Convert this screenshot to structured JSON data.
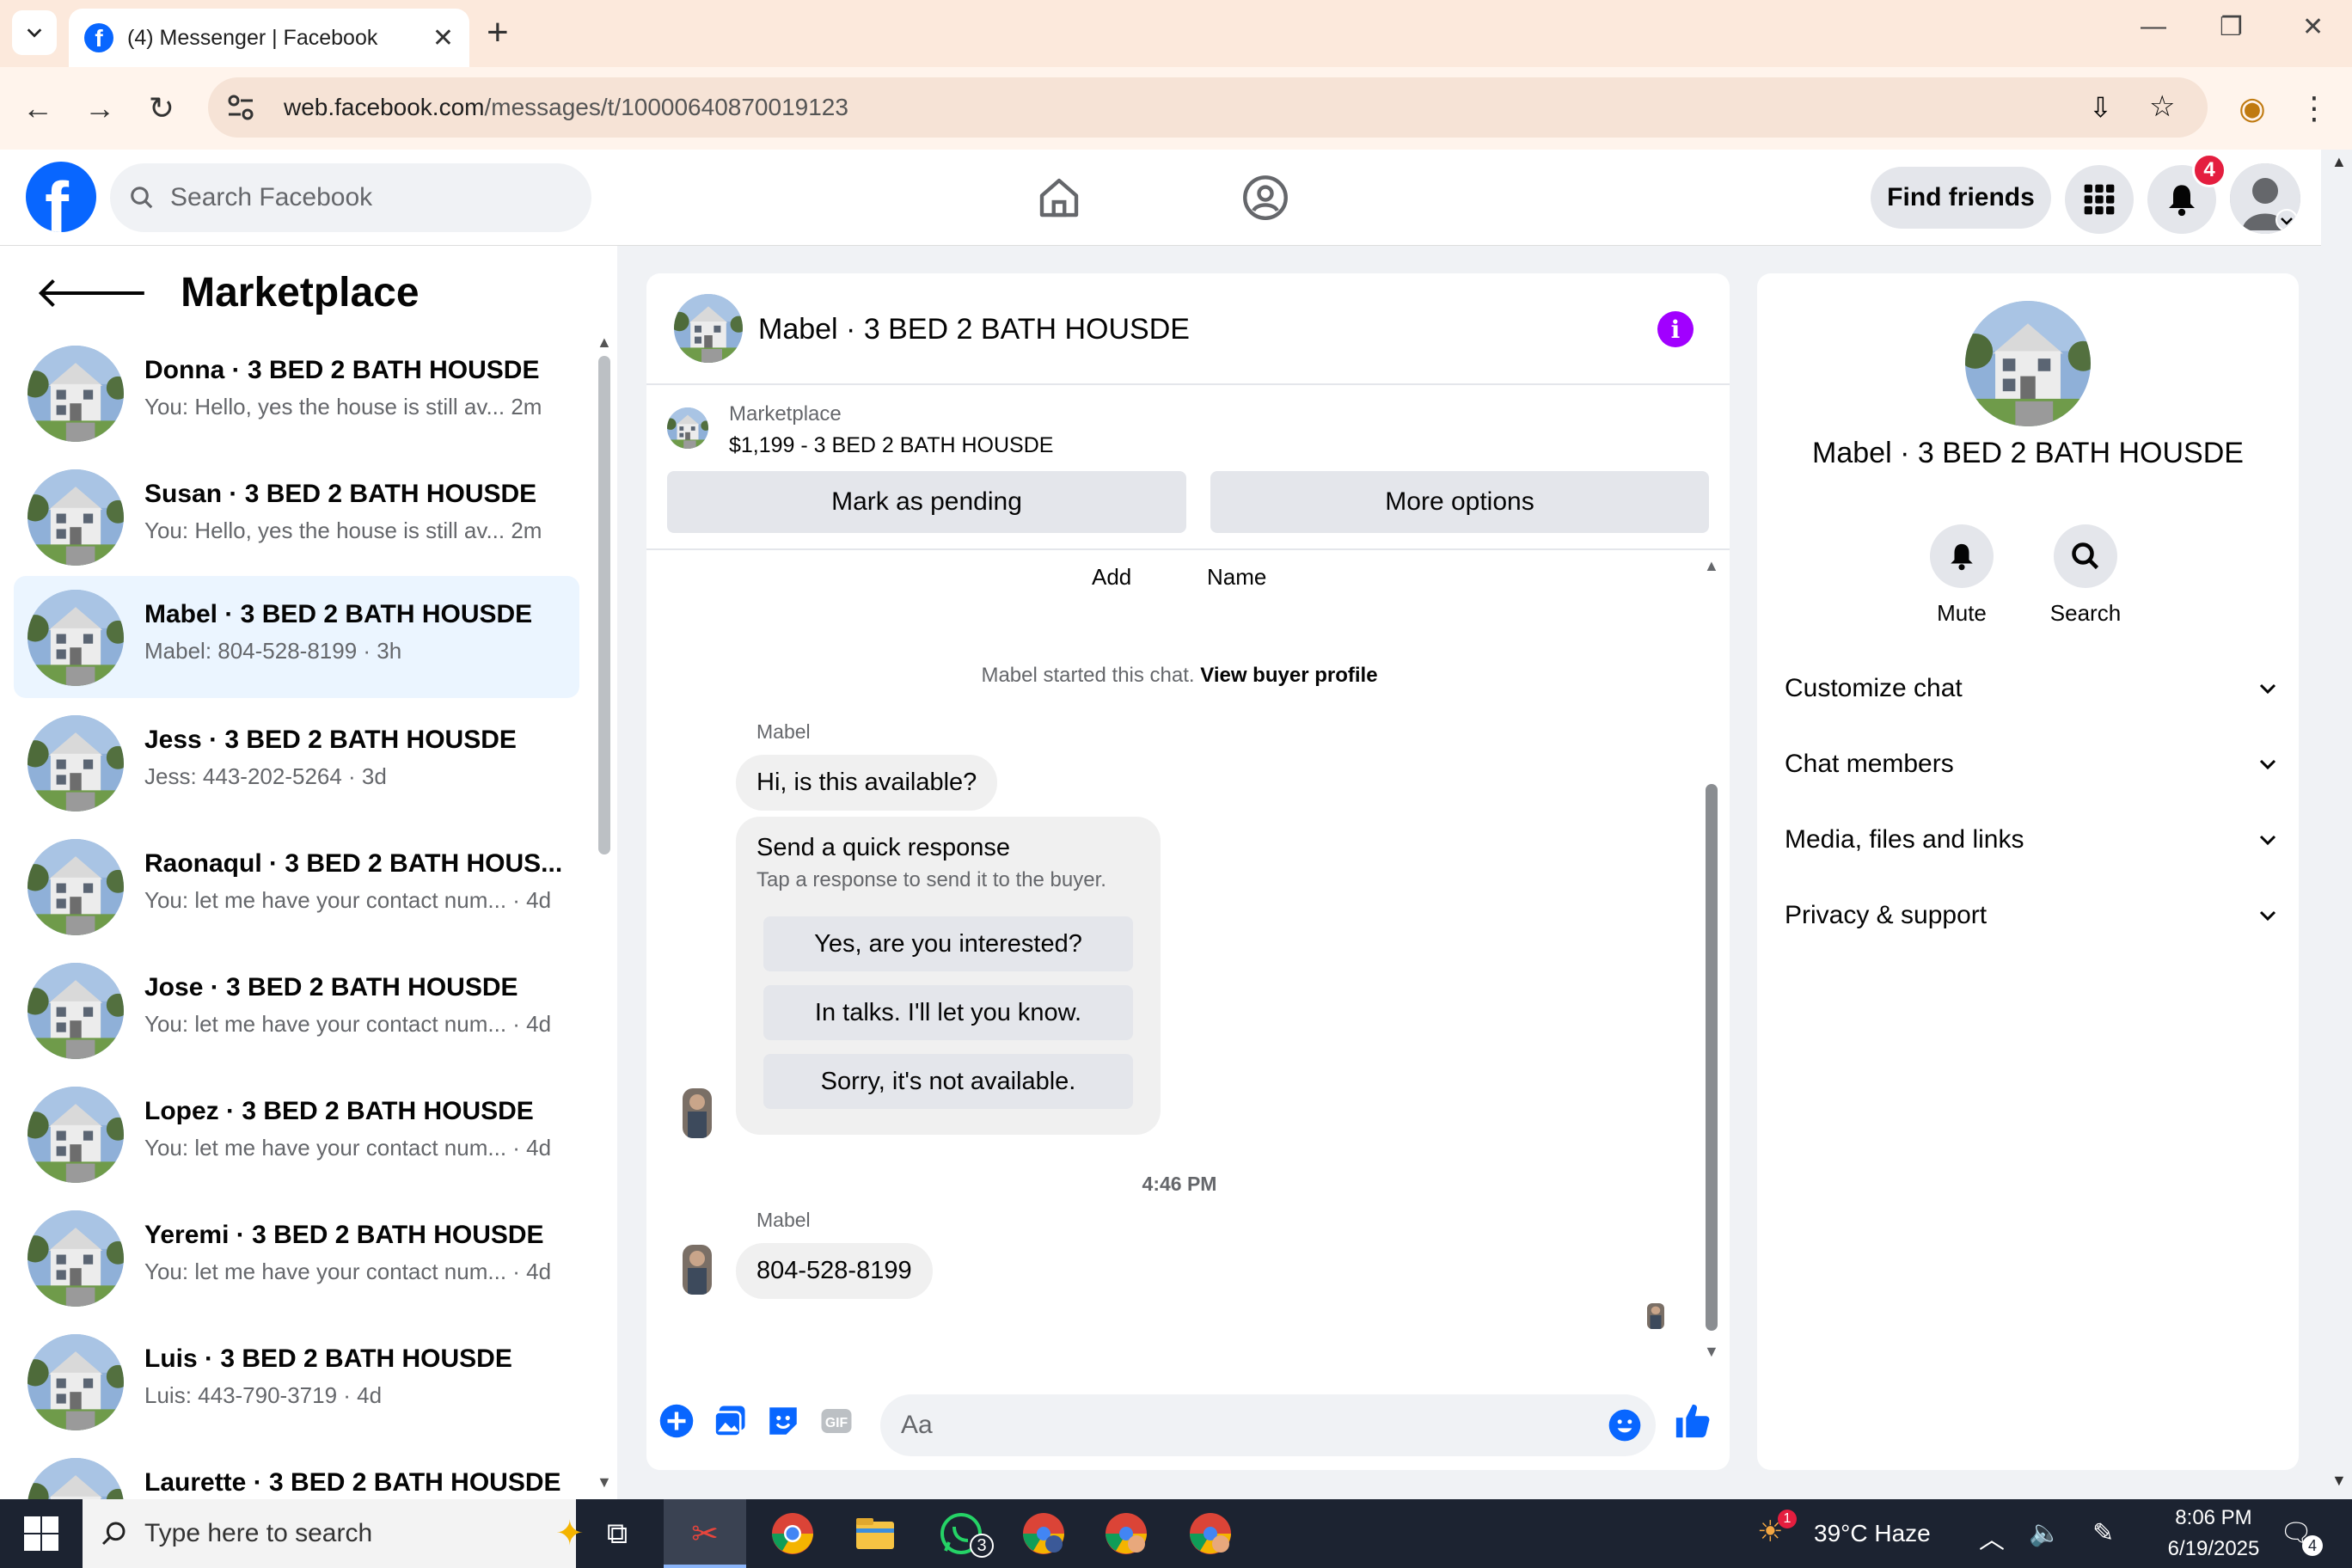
{
  "browser": {
    "tab_title": "(4) Messenger | Facebook",
    "url_host": "web.facebook.com",
    "url_path": "/messages/t/10000640870019123"
  },
  "fb": {
    "search_placeholder": "Search Facebook",
    "find_friends": "Find friends",
    "notification_count": "4"
  },
  "sidebar": {
    "title": "Marketplace",
    "conversations": [
      {
        "name": "Donna · 3 BED 2 BATH HOUSDE",
        "snippet": "You: Hello, yes the house is still av...   2m"
      },
      {
        "name": "Susan · 3 BED 2 BATH HOUSDE",
        "snippet": "You: Hello, yes the house is still av...   2m"
      },
      {
        "name": "Mabel · 3 BED 2 BATH HOUSDE",
        "snippet": "Mabel: 804-528-8199 · 3h"
      },
      {
        "name": "Jess · 3 BED 2 BATH HOUSDE",
        "snippet": "Jess: 443-202-5264 · 3d"
      },
      {
        "name": "Raonaqul · 3 BED 2 BATH HOUS...",
        "snippet": "You: let me have your contact num... · 4d"
      },
      {
        "name": "Jose · 3 BED 2 BATH HOUSDE",
        "snippet": "You: let me have your contact num... · 4d"
      },
      {
        "name": "Lopez · 3 BED 2 BATH HOUSDE",
        "snippet": "You: let me have your contact num... · 4d"
      },
      {
        "name": "Yeremi · 3 BED 2 BATH HOUSDE",
        "snippet": "You: let me have your contact num... · 4d"
      },
      {
        "name": "Luis · 3 BED 2 BATH HOUSDE",
        "snippet": "Luis: 443-790-3719 · 4d"
      },
      {
        "name": "Laurette · 3 BED 2 BATH HOUSDE",
        "snippet": ""
      }
    ]
  },
  "chat": {
    "title": "Mabel · 3 BED 2 BATH HOUSDE",
    "marketplace_label": "Marketplace",
    "listing": "$1,199 - 3 BED 2 BATH HOUSDE",
    "mark_pending": "Mark as pending",
    "more_options": "More options",
    "opt_add": "Add",
    "opt_name": "Name",
    "started_text": "Mabel started this chat.",
    "view_profile": "View buyer profile",
    "sender1": "Mabel",
    "msg1": "Hi, is this available?",
    "quick_title": "Send a quick response",
    "quick_sub": "Tap a response to send it to the buyer.",
    "quick_options": [
      "Yes, are you interested?",
      "In talks. I'll let you know.",
      "Sorry, it's not available."
    ],
    "timestamp": "4:46 PM",
    "sender2": "Mabel",
    "msg2": "804-528-8199",
    "composer_placeholder": "Aa"
  },
  "info_panel": {
    "title": "Mabel · 3 BED 2 BATH HOUSDE",
    "mute": "Mute",
    "search": "Search",
    "sections": [
      "Customize chat",
      "Chat members",
      "Media, files and links",
      "Privacy & support"
    ]
  },
  "taskbar": {
    "search_placeholder": "Type here to search",
    "whatsapp_badge": "3",
    "weather": "39°C  Haze",
    "weather_badge": "1",
    "time": "8:06 PM",
    "date": "6/19/2025",
    "notif_count": "4"
  },
  "colors": {
    "fb_blue": "#0866ff",
    "active_conv": "#ebf5ff",
    "info_purple": "#a100ff",
    "badge_red": "#e41e3f"
  }
}
